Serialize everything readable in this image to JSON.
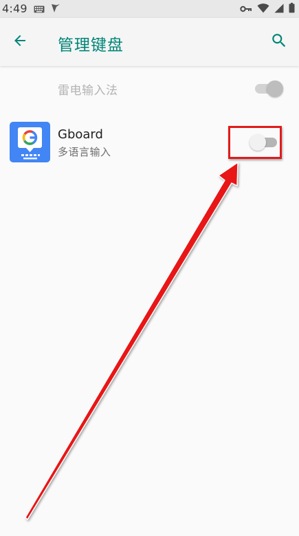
{
  "status_bar": {
    "time": "4:49",
    "left_icons": [
      "keyboard-icon",
      "app-notification-icon"
    ],
    "right_icons": [
      "vpn-key-icon",
      "wifi-icon",
      "signal-icon",
      "battery-icon"
    ]
  },
  "app_bar": {
    "title": "管理键盘",
    "back_icon": "arrow-back-icon",
    "search_icon": "search-icon"
  },
  "keyboards": [
    {
      "label": "雷电输入法",
      "subtitle": "",
      "enabled": true,
      "disabled": true
    },
    {
      "label": "Gboard",
      "subtitle": "多语言输入",
      "icon": "gboard-icon",
      "enabled": false,
      "disabled": false
    }
  ],
  "colors": {
    "accent": "#008577",
    "annotation": "#e11b1b",
    "gboard_icon_bg": "#4285f4"
  },
  "annotation": {
    "type": "arrow-and-box",
    "target": "gboard-toggle"
  }
}
